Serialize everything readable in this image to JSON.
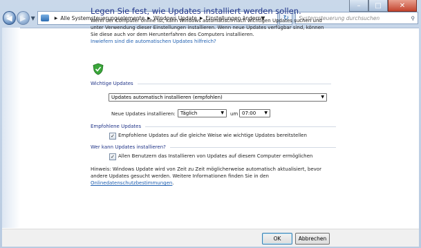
{
  "window": {
    "caption_buttons": [
      "–",
      "□",
      "✕"
    ]
  },
  "nav": {
    "back_icon": "back-arrow-icon",
    "forward_icon": "forward-arrow-icon",
    "breadcrumbs": [
      "Alle Systemsteuerungselemente",
      "Windows Update",
      "Einstellungen ändern"
    ],
    "search_placeholder": "Systemsteuerung durchsuchen"
  },
  "main": {
    "title": "Legen Sie fest, wie Updates installiert werden sollen.",
    "description": "Wenn der Computer online ist, kann Windows automatisch nach wichtigen Updates suchen und unter Verwendung dieser Einstellungen installieren. Wenn neue Updates verfügbar sind, können Sie diese auch vor dem Herunterfahren des Computers installieren.",
    "help_link": "Inwiefern sind die automatischen Updates hilfreich?",
    "important": {
      "heading": "Wichtige Updates",
      "mode_value": "Updates automatisch installieren (empfohlen)",
      "install_label": "Neue Updates installieren:",
      "day_value": "Täglich",
      "at_label": "um",
      "time_value": "07:00"
    },
    "recommended": {
      "heading": "Empfohlene Updates",
      "checkbox_label": "Empfohlene Updates auf die gleiche Weise wie wichtige Updates bereitstellen",
      "checked": true
    },
    "who": {
      "heading": "Wer kann Updates installieren?",
      "checkbox_label": "Allen Benutzern das Installieren von Updates auf diesem Computer ermöglichen",
      "checked": true
    },
    "hint_text": "Hinweis: Windows Update wird von Zeit zu Zeit möglicherweise automatisch aktualisiert, bevor andere Updates gesucht werden. Weitere Informationen finden Sie in den ",
    "hint_link": "Onlinedatenschutzbestimmungen",
    "hint_end": "."
  },
  "footer": {
    "ok_label": "OK",
    "cancel_label": "Abbrechen"
  },
  "colors": {
    "title": "#1e3287",
    "link": "#1f5fb0",
    "shield": "#3aa63a"
  }
}
